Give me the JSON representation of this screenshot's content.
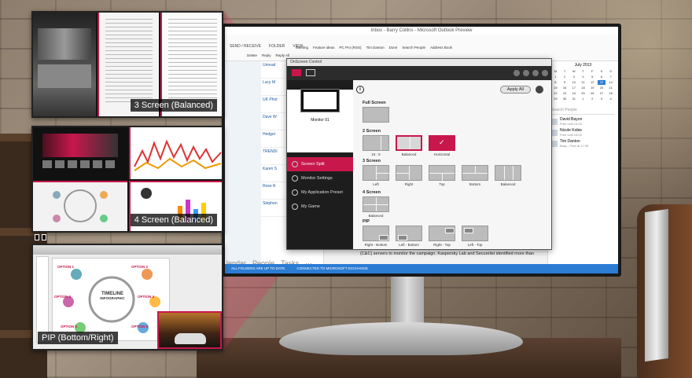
{
  "panels": {
    "three_screen": "3 Screen (Balanced)",
    "four_screen": "4 Screen (Balanced)",
    "pip": "PIP (Bottom/Right)"
  },
  "outlook": {
    "window_title": "Inbox - Barry Collins - Microsoft Outlook Preview",
    "tabs": [
      "SEND / RECEIVE",
      "FOLDER",
      "VIEW"
    ],
    "ribbon": [
      "Meeting",
      "Feature ideas",
      "PC Pro (RSS)",
      "Tim Danton",
      "Done",
      "Search People",
      "Address Book"
    ],
    "ribbon_actions": [
      "Delete",
      "Reply",
      "Reply All"
    ],
    "list_items": [
      "Unread",
      "Lucy M",
      "UK Phot",
      "Dave W",
      "Hedger",
      "TRENDI",
      "Karen S",
      "Rose R",
      "Stephen"
    ],
    "calendar_title": "July 2013",
    "calendar_days": [
      "M",
      "T",
      "W",
      "T",
      "F",
      "S",
      "S",
      "1",
      "2",
      "3",
      "4",
      "5",
      "6",
      "7",
      "8",
      "9",
      "10",
      "11",
      "12",
      "13",
      "14",
      "15",
      "16",
      "17",
      "18",
      "19",
      "20",
      "21",
      "22",
      "23",
      "24",
      "25",
      "26",
      "27",
      "28",
      "29",
      "30",
      "31",
      "1",
      "2",
      "3",
      "4"
    ],
    "people_header": "Search People",
    "people": [
      {
        "name": "David Bayon",
        "status": "Free until 15:00"
      },
      {
        "name": "Nicole Kobie",
        "status": "Free until 15:00"
      },
      {
        "name": "Tim Danton",
        "status": "Busy - Free at 17:30"
      }
    ],
    "bottom_nav": [
      "lendar",
      "People",
      "Tasks",
      "···"
    ],
    "reading_text": "(C&C) servers to monitor the campaign. Kaspersky Lab and Securelist identified more than",
    "status_items": [
      "ALL FOLDERS ARE UP TO DATE.",
      "CONNECTED TO MICROSOFT EXCHANGE"
    ]
  },
  "osc": {
    "title": "OnScreen Control",
    "monitor_label": "Monitor 01",
    "apply_all": "Apply All",
    "info_icon": "i",
    "menu": [
      {
        "label": "Screen Split",
        "active": true
      },
      {
        "label": "Monitor Settings",
        "active": false
      },
      {
        "label": "My Application Preset",
        "active": false
      },
      {
        "label": "My Game",
        "active": false
      }
    ],
    "sections": {
      "full": "Full Screen",
      "two": "2 Screen",
      "three": "3 Screen",
      "four": "4 Screen",
      "pip": "PIP"
    },
    "two_caps": [
      "16 : 5",
      "Balanced",
      "Horizontal"
    ],
    "three_caps": [
      "Left",
      "Right",
      "Top",
      "Bottom",
      "Balanced"
    ],
    "four_caps": [
      "Balanced"
    ],
    "pip_caps": [
      "Right - Bottom",
      "Left - Bottom",
      "Right - Top",
      "Left - Top"
    ]
  },
  "colors": {
    "accent": "#c8174b",
    "outlook_blue": "#2b7cd3"
  },
  "pip_content": {
    "infographic_title": "TIMELINE",
    "infographic_subtitle": "INFOGRAPHIC",
    "options": [
      "OPTION 1",
      "OPTION 2",
      "OPTION 3",
      "OPTION 4",
      "OPTION 5",
      "OPTION 6"
    ]
  }
}
